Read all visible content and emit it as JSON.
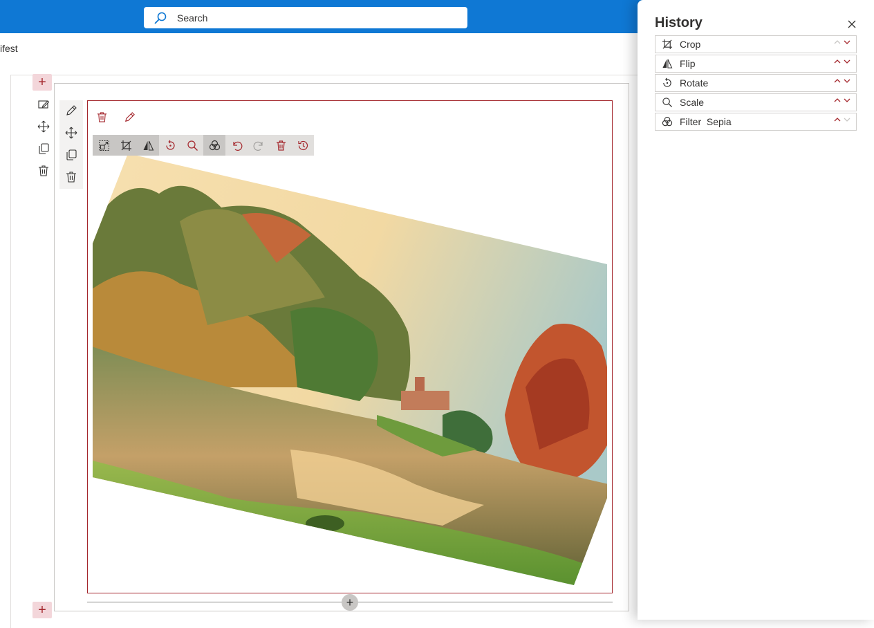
{
  "header": {
    "search_placeholder": "Search",
    "brand_color": "#0f78d4"
  },
  "breadcrumb": {
    "text": "ifest"
  },
  "section_tools": [
    "edit-section-icon",
    "move-icon",
    "duplicate-icon",
    "delete-icon"
  ],
  "webpart_tools": [
    "edit-icon",
    "move-icon",
    "duplicate-icon",
    "delete-icon"
  ],
  "image_toolbar": [
    {
      "name": "resize-icon",
      "active": true
    },
    {
      "name": "crop-icon",
      "active": true
    },
    {
      "name": "flip-icon",
      "active": true
    },
    {
      "name": "rotate-icon",
      "active": false
    },
    {
      "name": "scale-icon",
      "active": false
    },
    {
      "name": "filter-icon",
      "active": true
    },
    {
      "name": "undo-icon",
      "active": false
    },
    {
      "name": "redo-icon",
      "active": false
    },
    {
      "name": "delete-icon",
      "active": false
    },
    {
      "name": "history-icon",
      "active": false
    }
  ],
  "history": {
    "title": "History",
    "items": [
      {
        "label": "Crop",
        "icon": "crop-icon",
        "can_move_up": false,
        "can_move_down": true
      },
      {
        "label": "Flip",
        "icon": "flip-icon",
        "can_move_up": true,
        "can_move_down": true
      },
      {
        "label": "Rotate",
        "icon": "rotate-icon",
        "can_move_up": true,
        "can_move_down": true
      },
      {
        "label": "Scale",
        "icon": "scale-icon",
        "can_move_up": true,
        "can_move_down": true
      },
      {
        "label": "Filter  Sepia",
        "icon": "filter-icon",
        "can_move_up": true,
        "can_move_down": false
      }
    ]
  },
  "colors": {
    "accent_red": "#a4262c",
    "toolbar_bg": "#e1dfdd"
  }
}
